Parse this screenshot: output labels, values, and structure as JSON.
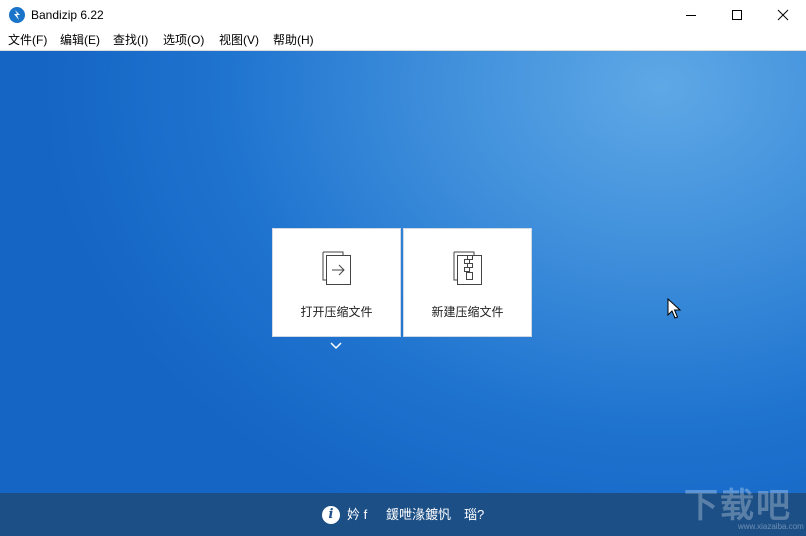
{
  "window": {
    "title": "Bandizip 6.22"
  },
  "menu": {
    "items": [
      {
        "label": "文件(F)"
      },
      {
        "label": "编辑(E)"
      },
      {
        "label": "查找(I)"
      },
      {
        "label": "选项(O)"
      },
      {
        "label": "视图(V)"
      },
      {
        "label": "帮助(H)"
      }
    ]
  },
  "main": {
    "open_archive_label": "打开压缩文件",
    "new_archive_label": "新建压缩文件"
  },
  "status": {
    "text_1": "妗 f",
    "text_2": "鍰呭湪鍍忛",
    "text_3": "瑙?"
  },
  "watermark": {
    "text": "下载吧",
    "sub": "www.xiazaiba.com"
  },
  "colors": {
    "accent": "#1a74c9",
    "background_main": "#1f74cf",
    "statusbar": "#1c4f86"
  },
  "icons": {
    "app": "bandizip-logo-icon",
    "open": "open-archive-icon",
    "new": "new-archive-icon",
    "info": "info-icon"
  }
}
